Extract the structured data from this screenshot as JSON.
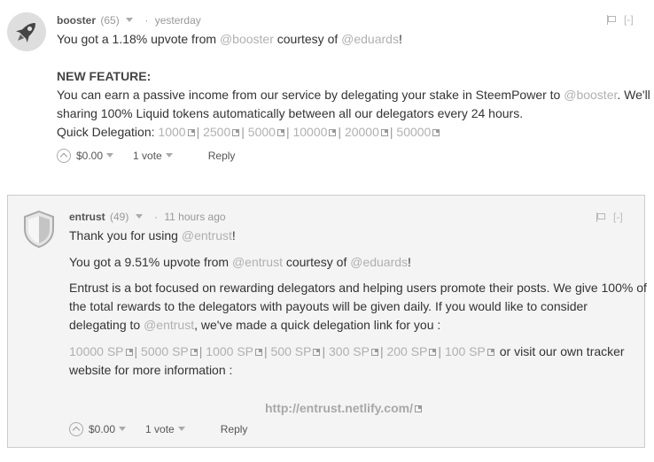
{
  "comment1": {
    "author": "booster",
    "reputation": "(65)",
    "time": "yesterday",
    "collapse": "[-]",
    "line1_pre": "You got a 1.18% upvote from ",
    "line1_link1": "@booster",
    "line1_mid": " courtesy of ",
    "line1_link2": "@eduards",
    "line1_post": "!",
    "feature_heading": "NEW FEATURE:",
    "para_line1_pre": "You can earn a passive income from our service by delegating your stake in SteemPower to ",
    "para_line1_link": "@booster",
    "para_line1_post": ". We'll be",
    "para_line2": "sharing 100% Liquid tokens automatically between all our delegators every 24 hours.",
    "quick_label": "Quick Delegation: ",
    "quick_links": [
      "1000",
      "2500",
      "5000",
      "10000",
      "20000",
      "50000"
    ],
    "payout": "$0.00",
    "votes": "1 vote",
    "reply": "Reply"
  },
  "comment2": {
    "author": "entrust",
    "reputation": "(49)",
    "time": "11 hours ago",
    "collapse": "[-]",
    "thanks_pre": "Thank you for using ",
    "thanks_link": "@entrust",
    "thanks_post": "!",
    "upvote_pre": "You got a 9.51% upvote from ",
    "upvote_link1": "@entrust",
    "upvote_mid": " courtesy of ",
    "upvote_link2": "@eduards",
    "upvote_post": "!",
    "para_line1": "Entrust is a bot focused on rewarding delegators and helping users promote their posts. We give 100% of",
    "para_line2": "the total rewards to the delegators with payouts will be given daily. If you would like to consider",
    "para_line3_pre": "delegating to ",
    "para_line3_link": "@entrust",
    "para_line3_post": ", we've made a quick delegation link for you :",
    "sp_links": [
      "10000 SP",
      "5000 SP",
      "1000 SP",
      "500 SP",
      "300 SP",
      "200 SP",
      "100 SP"
    ],
    "sp_tail": " or visit our own tracker",
    "website_line": "website for more information :",
    "url": "http://entrust.netlify.com/",
    "payout": "$0.00",
    "votes": "1 vote",
    "reply": "Reply"
  }
}
